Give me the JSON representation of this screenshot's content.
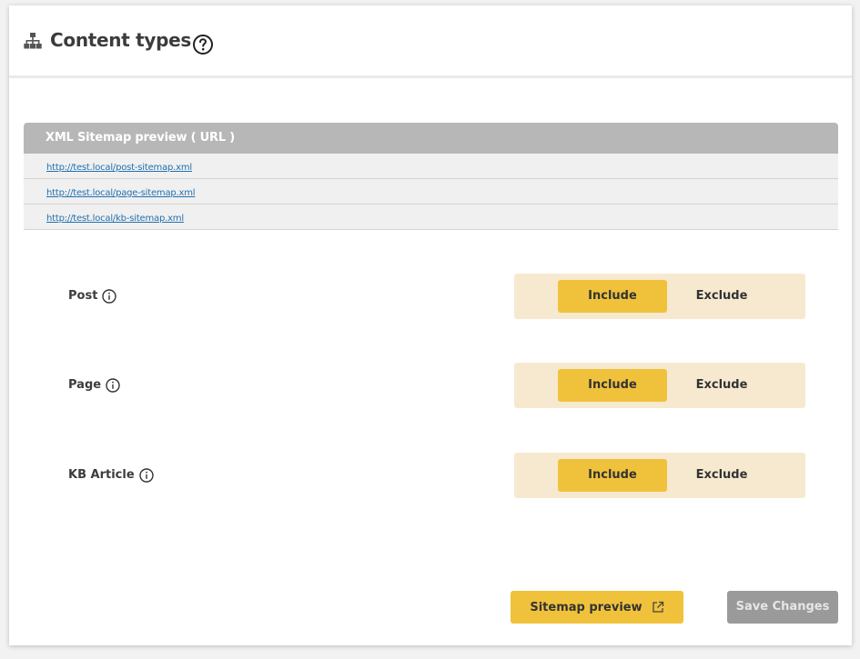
{
  "header": {
    "title": "Content types",
    "icon": "sitemap-icon",
    "help_icon": "help-circle-icon"
  },
  "preview": {
    "heading": "XML Sitemap preview ( URL )",
    "urls": [
      "http://test.local/post-sitemap.xml",
      "http://test.local/page-sitemap.xml",
      "http://test.local/kb-sitemap.xml"
    ]
  },
  "content_types": [
    {
      "label": "Post",
      "include_label": "Include",
      "exclude_label": "Exclude",
      "selected": "Include"
    },
    {
      "label": "Page",
      "include_label": "Include",
      "exclude_label": "Exclude",
      "selected": "Include"
    },
    {
      "label": "KB Article",
      "include_label": "Include",
      "exclude_label": "Exclude",
      "selected": "Include"
    }
  ],
  "footer": {
    "preview_button": "Sitemap preview",
    "preview_icon": "external-link-icon",
    "save_button": "Save Changes"
  },
  "colors": {
    "accent": "#f0c23b",
    "toggle_bg": "#f7e9d0",
    "table_head": "#b7b7b7",
    "link": "#2271b1",
    "save_disabled": "#9a9a9a"
  }
}
